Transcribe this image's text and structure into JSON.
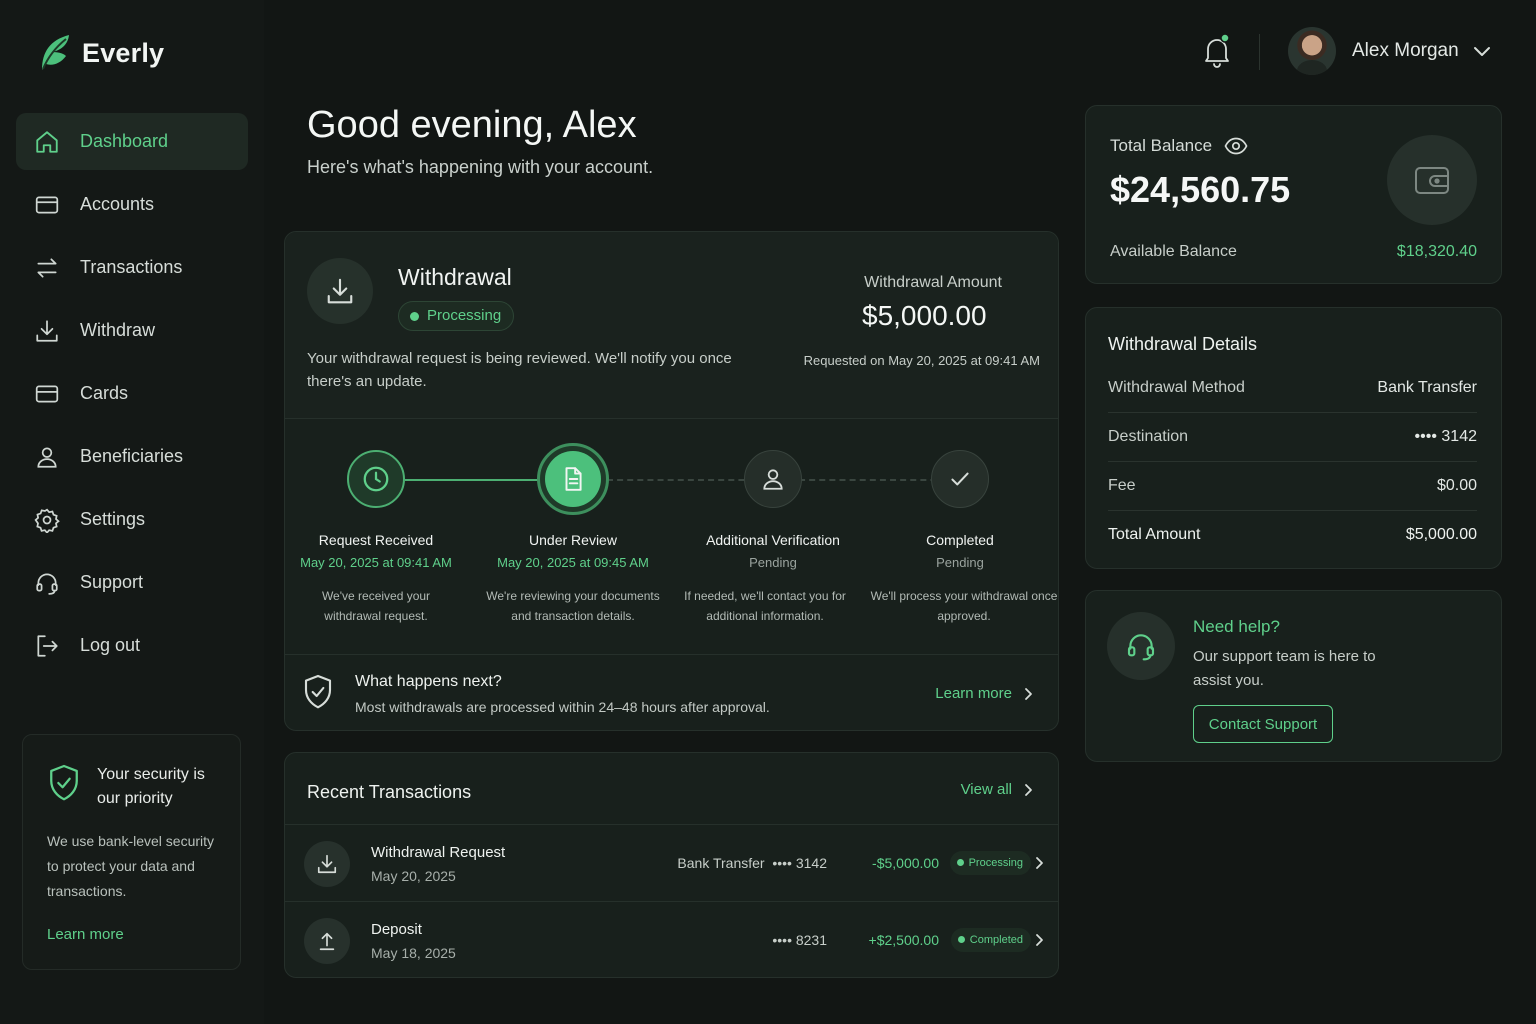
{
  "app": {
    "name": "Everly"
  },
  "sidebar": {
    "items": [
      {
        "label": "Dashboard",
        "icon": "home-icon",
        "active": true
      },
      {
        "label": "Accounts",
        "icon": "wallet-icon"
      },
      {
        "label": "Transactions",
        "icon": "swap-icon"
      },
      {
        "label": "Withdraw",
        "icon": "download-icon"
      },
      {
        "label": "Cards",
        "icon": "card-icon"
      },
      {
        "label": "Beneficiaries",
        "icon": "user-icon"
      },
      {
        "label": "Settings",
        "icon": "gear-icon"
      },
      {
        "label": "Support",
        "icon": "headset-icon"
      },
      {
        "label": "Log out",
        "icon": "logout-icon"
      }
    ],
    "security": {
      "title": "Your security is our priority",
      "body": "We use bank-level security to protect your data and transactions.",
      "link": "Learn more"
    }
  },
  "header": {
    "user_name": "Alex Morgan"
  },
  "greeting": {
    "title": "Good evening, Alex",
    "subtitle": "Here's what's happening with your account."
  },
  "withdrawal": {
    "title": "Withdrawal",
    "status": "Processing",
    "description": "Your withdrawal request is being reviewed. We'll notify you once there's an update.",
    "amount_label": "Withdrawal Amount",
    "amount": "$5,000.00",
    "requested": "Requested on May 20, 2025 at 09:41 AM",
    "steps": [
      {
        "name": "Request Received",
        "date": "May 20, 2025 at 09:41 AM",
        "desc": "We've received your withdrawal request.",
        "state": "done"
      },
      {
        "name": "Under Review",
        "date": "May 20, 2025 at 09:45 AM",
        "desc": "We're reviewing your documents and transaction details.",
        "state": "current"
      },
      {
        "name": "Additional Verification",
        "date": "Pending",
        "desc": "If needed, we'll contact you for additional information.",
        "state": "pending"
      },
      {
        "name": "Completed",
        "date": "Pending",
        "desc": "We'll process your withdrawal once approved.",
        "state": "pending"
      }
    ],
    "next": {
      "title": "What happens next?",
      "desc": "Most withdrawals are processed within 24–48 hours after approval.",
      "link": "Learn more"
    }
  },
  "transactions": {
    "title": "Recent Transactions",
    "view_all": "View all",
    "rows": [
      {
        "name": "Withdrawal Request",
        "date": "May 20, 2025",
        "method": "Bank Transfer  •••• 3142",
        "amount": "-$5,000.00",
        "status": "Processing",
        "icon": "download-icon"
      },
      {
        "name": "Deposit",
        "date": "May 18, 2025",
        "method": "•••• 8231",
        "amount": "+$2,500.00",
        "status": "Completed",
        "icon": "upload-icon"
      }
    ]
  },
  "balance": {
    "label": "Total Balance",
    "amount": "$24,560.75",
    "available_label": "Available Balance",
    "available_amount": "$18,320.40"
  },
  "details": {
    "title": "Withdrawal Details",
    "rows": [
      {
        "k": "Withdrawal Method",
        "v": "Bank Transfer"
      },
      {
        "k": "Destination",
        "v": "•••• 3142"
      },
      {
        "k": "Fee",
        "v": "$0.00"
      },
      {
        "k": "Total Amount",
        "v": "$5,000.00"
      }
    ]
  },
  "help": {
    "title": "Need help?",
    "desc": "Our support team is here to assist you.",
    "button": "Contact Support"
  },
  "colors": {
    "accent": "#5fd08b",
    "background": "#121614",
    "card": "#18201c"
  }
}
